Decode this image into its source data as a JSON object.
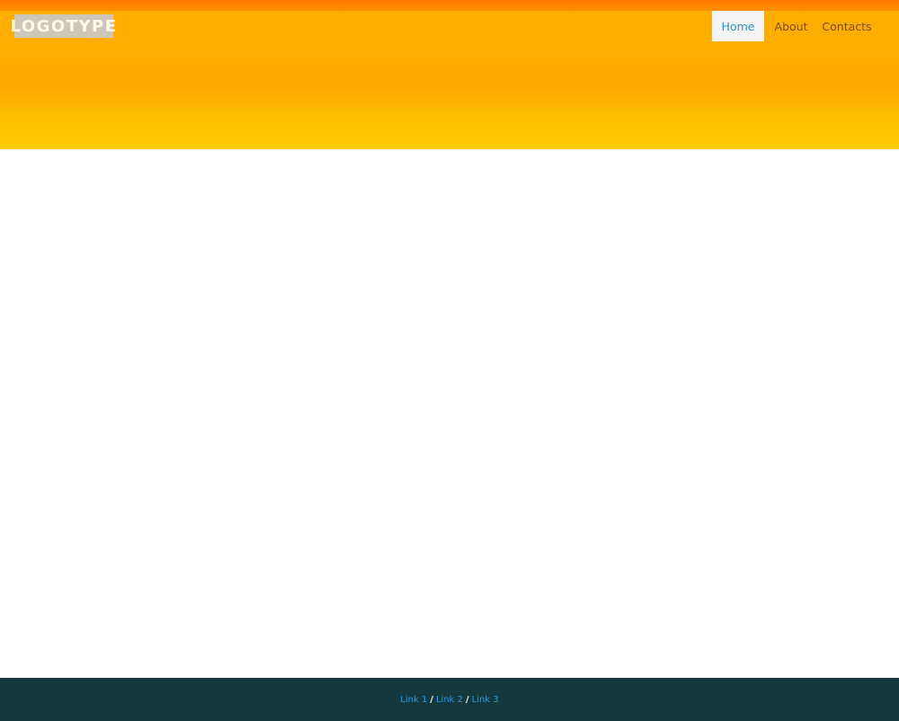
{
  "header": {
    "logo_text": "LOGOTYPE"
  },
  "nav": {
    "items": [
      {
        "label": "Home",
        "active": true
      },
      {
        "label": "About",
        "active": false
      },
      {
        "label": "Contacts",
        "active": false
      }
    ]
  },
  "footer": {
    "links": [
      {
        "label": "Link 1"
      },
      {
        "label": "Link 2"
      },
      {
        "label": "Link 3"
      }
    ],
    "separator": "/"
  },
  "colors": {
    "header_top": "#ff8a00",
    "header_bottom": "#ffcb08",
    "nav_active_bg": "#f4f4f4",
    "nav_active_text": "#2a8fd0",
    "nav_text": "#7a4a12",
    "footer_bg": "#15373e",
    "footer_link": "#2a9de0"
  }
}
